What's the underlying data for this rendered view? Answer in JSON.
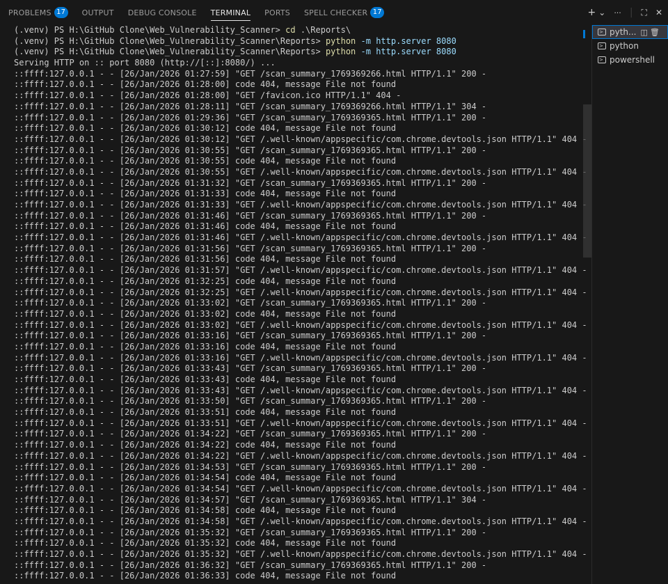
{
  "tabs": [
    {
      "label": "PROBLEMS",
      "badge": "17",
      "active": false
    },
    {
      "label": "OUTPUT",
      "badge": "",
      "active": false
    },
    {
      "label": "DEBUG CONSOLE",
      "badge": "",
      "active": false
    },
    {
      "label": "TERMINAL",
      "badge": "",
      "active": true
    },
    {
      "label": "PORTS",
      "badge": "",
      "active": false
    },
    {
      "label": "SPELL CHECKER",
      "badge": "17",
      "active": false
    }
  ],
  "actions": {
    "add": "+",
    "dropdown": "⌄",
    "more": "···",
    "maximize": "⛶",
    "close": "✕"
  },
  "terminal_instances": [
    {
      "label": "pyth...",
      "active": true
    },
    {
      "label": "python",
      "active": false
    },
    {
      "label": "powershell",
      "active": false
    }
  ],
  "colors": {
    "accent": "#0078d4",
    "command": "#dcdcaa",
    "argument": "#9cdcfe",
    "text": "#cccccc"
  },
  "terminal": {
    "prompts": [
      {
        "prompt": "(.venv) PS H:\\GitHub Clone\\Web_Vulnerability_Scanner> ",
        "cmd": "cd",
        "args": " .\\Reports\\"
      },
      {
        "prompt": "(.venv) PS H:\\GitHub Clone\\Web_Vulnerability_Scanner\\Reports> ",
        "cmd": "python",
        "args": " -m http.server 8080"
      },
      {
        "prompt": "(.venv) PS H:\\GitHub Clone\\Web_Vulnerability_Scanner\\Reports> ",
        "cmd": "python",
        "args": " -m http.server 8080"
      }
    ],
    "output": [
      "Serving HTTP on :: port 8080 (http://[::]:8080/) ...",
      "::ffff:127.0.0.1 - - [26/Jan/2026 01:27:59] \"GET /scan_summary_1769369266.html HTTP/1.1\" 200 -",
      "::ffff:127.0.0.1 - - [26/Jan/2026 01:28:00] code 404, message File not found",
      "::ffff:127.0.0.1 - - [26/Jan/2026 01:28:00] \"GET /favicon.ico HTTP/1.1\" 404 -",
      "::ffff:127.0.0.1 - - [26/Jan/2026 01:28:11] \"GET /scan_summary_1769369266.html HTTP/1.1\" 304 -",
      "::ffff:127.0.0.1 - - [26/Jan/2026 01:29:36] \"GET /scan_summary_1769369365.html HTTP/1.1\" 200 -",
      "::ffff:127.0.0.1 - - [26/Jan/2026 01:30:12] code 404, message File not found",
      "::ffff:127.0.0.1 - - [26/Jan/2026 01:30:12] \"GET /.well-known/appspecific/com.chrome.devtools.json HTTP/1.1\" 404 -",
      "::ffff:127.0.0.1 - - [26/Jan/2026 01:30:55] \"GET /scan_summary_1769369365.html HTTP/1.1\" 200 -",
      "::ffff:127.0.0.1 - - [26/Jan/2026 01:30:55] code 404, message File not found",
      "::ffff:127.0.0.1 - - [26/Jan/2026 01:30:55] \"GET /.well-known/appspecific/com.chrome.devtools.json HTTP/1.1\" 404 -",
      "::ffff:127.0.0.1 - - [26/Jan/2026 01:31:32] \"GET /scan_summary_1769369365.html HTTP/1.1\" 200 -",
      "::ffff:127.0.0.1 - - [26/Jan/2026 01:31:33] code 404, message File not found",
      "::ffff:127.0.0.1 - - [26/Jan/2026 01:31:33] \"GET /.well-known/appspecific/com.chrome.devtools.json HTTP/1.1\" 404 -",
      "::ffff:127.0.0.1 - - [26/Jan/2026 01:31:46] \"GET /scan_summary_1769369365.html HTTP/1.1\" 200 -",
      "::ffff:127.0.0.1 - - [26/Jan/2026 01:31:46] code 404, message File not found",
      "::ffff:127.0.0.1 - - [26/Jan/2026 01:31:46] \"GET /.well-known/appspecific/com.chrome.devtools.json HTTP/1.1\" 404 -",
      "::ffff:127.0.0.1 - - [26/Jan/2026 01:31:56] \"GET /scan_summary_1769369365.html HTTP/1.1\" 200 -",
      "::ffff:127.0.0.1 - - [26/Jan/2026 01:31:56] code 404, message File not found",
      "::ffff:127.0.0.1 - - [26/Jan/2026 01:31:57] \"GET /.well-known/appspecific/com.chrome.devtools.json HTTP/1.1\" 404 -",
      "::ffff:127.0.0.1 - - [26/Jan/2026 01:32:25] code 404, message File not found",
      "::ffff:127.0.0.1 - - [26/Jan/2026 01:32:25] \"GET /.well-known/appspecific/com.chrome.devtools.json HTTP/1.1\" 404 -",
      "::ffff:127.0.0.1 - - [26/Jan/2026 01:33:02] \"GET /scan_summary_1769369365.html HTTP/1.1\" 200 -",
      "::ffff:127.0.0.1 - - [26/Jan/2026 01:33:02] code 404, message File not found",
      "::ffff:127.0.0.1 - - [26/Jan/2026 01:33:02] \"GET /.well-known/appspecific/com.chrome.devtools.json HTTP/1.1\" 404 -",
      "::ffff:127.0.0.1 - - [26/Jan/2026 01:33:16] \"GET /scan_summary_1769369365.html HTTP/1.1\" 200 -",
      "::ffff:127.0.0.1 - - [26/Jan/2026 01:33:16] code 404, message File not found",
      "::ffff:127.0.0.1 - - [26/Jan/2026 01:33:16] \"GET /.well-known/appspecific/com.chrome.devtools.json HTTP/1.1\" 404 -",
      "::ffff:127.0.0.1 - - [26/Jan/2026 01:33:43] \"GET /scan_summary_1769369365.html HTTP/1.1\" 200 -",
      "::ffff:127.0.0.1 - - [26/Jan/2026 01:33:43] code 404, message File not found",
      "::ffff:127.0.0.1 - - [26/Jan/2026 01:33:43] \"GET /.well-known/appspecific/com.chrome.devtools.json HTTP/1.1\" 404 -",
      "::ffff:127.0.0.1 - - [26/Jan/2026 01:33:50] \"GET /scan_summary_1769369365.html HTTP/1.1\" 200 -",
      "::ffff:127.0.0.1 - - [26/Jan/2026 01:33:51] code 404, message File not found",
      "::ffff:127.0.0.1 - - [26/Jan/2026 01:33:51] \"GET /.well-known/appspecific/com.chrome.devtools.json HTTP/1.1\" 404 -",
      "::ffff:127.0.0.1 - - [26/Jan/2026 01:34:22] \"GET /scan_summary_1769369365.html HTTP/1.1\" 200 -",
      "::ffff:127.0.0.1 - - [26/Jan/2026 01:34:22] code 404, message File not found",
      "::ffff:127.0.0.1 - - [26/Jan/2026 01:34:22] \"GET /.well-known/appspecific/com.chrome.devtools.json HTTP/1.1\" 404 -",
      "::ffff:127.0.0.1 - - [26/Jan/2026 01:34:53] \"GET /scan_summary_1769369365.html HTTP/1.1\" 200 -",
      "::ffff:127.0.0.1 - - [26/Jan/2026 01:34:54] code 404, message File not found",
      "::ffff:127.0.0.1 - - [26/Jan/2026 01:34:54] \"GET /.well-known/appspecific/com.chrome.devtools.json HTTP/1.1\" 404 -",
      "::ffff:127.0.0.1 - - [26/Jan/2026 01:34:57] \"GET /scan_summary_1769369365.html HTTP/1.1\" 304 -",
      "::ffff:127.0.0.1 - - [26/Jan/2026 01:34:58] code 404, message File not found",
      "::ffff:127.0.0.1 - - [26/Jan/2026 01:34:58] \"GET /.well-known/appspecific/com.chrome.devtools.json HTTP/1.1\" 404 -",
      "::ffff:127.0.0.1 - - [26/Jan/2026 01:35:32] \"GET /scan_summary_1769369365.html HTTP/1.1\" 200 -",
      "::ffff:127.0.0.1 - - [26/Jan/2026 01:35:32] code 404, message File not found",
      "::ffff:127.0.0.1 - - [26/Jan/2026 01:35:32] \"GET /.well-known/appspecific/com.chrome.devtools.json HTTP/1.1\" 404 -",
      "::ffff:127.0.0.1 - - [26/Jan/2026 01:36:32] \"GET /scan_summary_1769369365.html HTTP/1.1\" 200 -",
      "::ffff:127.0.0.1 - - [26/Jan/2026 01:36:33] code 404, message File not found"
    ]
  }
}
